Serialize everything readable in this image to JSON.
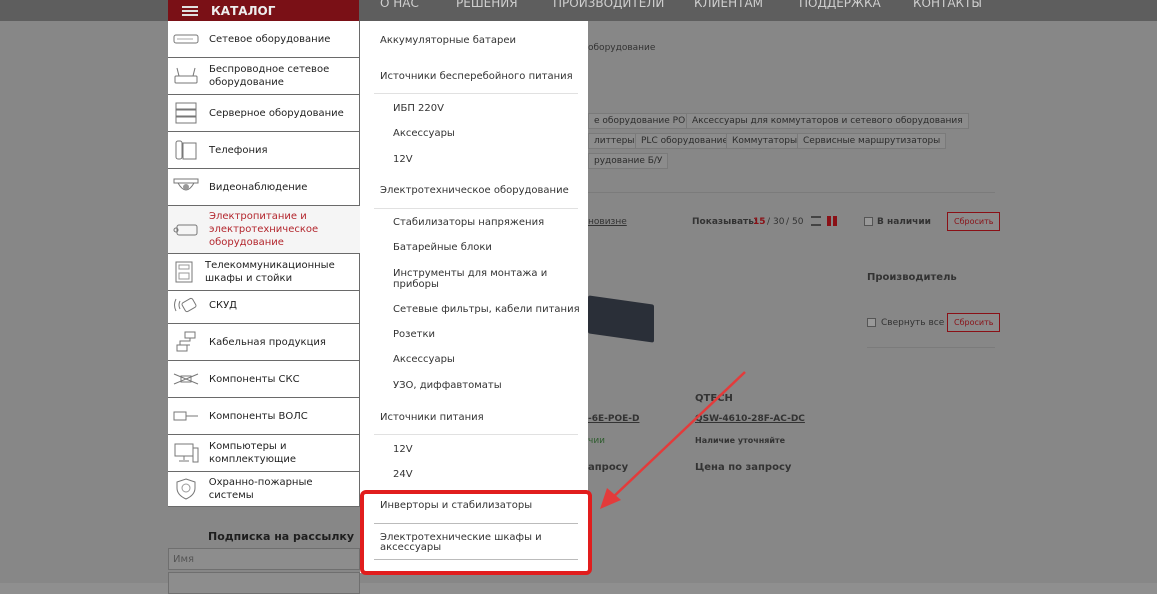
{
  "header": {
    "catalog_label": "КАТАЛОГ",
    "nav": [
      "О НАС",
      "РЕШЕНИЯ",
      "ПРОИЗВОДИТЕЛИ",
      "КЛИЕНТАМ",
      "ПОДДЕРЖКА",
      "КОНТАКТЫ"
    ]
  },
  "left_menu": [
    {
      "label": "Сетевое оборудование",
      "icon": "switch-icon"
    },
    {
      "label": "Беспроводное сетевое оборудование",
      "icon": "wifi-router-icon"
    },
    {
      "label": "Серверное оборудование",
      "icon": "server-icon"
    },
    {
      "label": "Телефония",
      "icon": "phone-icon"
    },
    {
      "label": "Видеонаблюдение",
      "icon": "camera-icon"
    },
    {
      "label": "Электропитание и электротехническое оборудование",
      "icon": "power-icon",
      "active": true
    },
    {
      "label": "Телекоммуникационные шкафы и стойки",
      "icon": "rack-icon"
    },
    {
      "label": "СКУД",
      "icon": "access-control-icon"
    },
    {
      "label": "Кабельная продукция",
      "icon": "cable-icon"
    },
    {
      "label": "Компоненты СКС",
      "icon": "scs-icon"
    },
    {
      "label": "Компоненты ВОЛС",
      "icon": "fiber-icon"
    },
    {
      "label": "Компьютеры и комплектующие",
      "icon": "computer-icon"
    },
    {
      "label": "Охранно-пожарные системы",
      "icon": "shield-icon"
    }
  ],
  "right_menu": {
    "items": [
      {
        "label": "Аккумуляторные батареи",
        "type": "head"
      },
      {
        "label": "Источники бесперебойного питания",
        "type": "head"
      },
      {
        "label": "ИБП 220V",
        "type": "sub"
      },
      {
        "label": "Аксессуары",
        "type": "sub"
      },
      {
        "label": "12V",
        "type": "sub"
      },
      {
        "label": "Электротехническое оборудование",
        "type": "head"
      },
      {
        "label": "Стабилизаторы напряжения",
        "type": "sub"
      },
      {
        "label": "Батарейные блоки",
        "type": "sub"
      },
      {
        "label": "Инструменты для монтажа и приборы",
        "type": "sub"
      },
      {
        "label": "Сетевые фильтры, кабели питания",
        "type": "sub"
      },
      {
        "label": "Розетки",
        "type": "sub"
      },
      {
        "label": "Аксессуары",
        "type": "sub"
      },
      {
        "label": "УЗО, диффавтоматы",
        "type": "sub"
      },
      {
        "label": "Источники питания",
        "type": "head"
      },
      {
        "label": "12V",
        "type": "sub"
      },
      {
        "label": "24V",
        "type": "sub"
      },
      {
        "label": "Инверторы и стабилизаторы",
        "type": "head"
      },
      {
        "label": "Электротехнические шкафы и аксессуары",
        "type": "head"
      }
    ]
  },
  "background": {
    "breadcrumb_tail": "оборудование",
    "chips": [
      "е оборудование PON",
      "Аксессуары для коммутаторов и сетевого оборудования",
      "литтеры",
      "PLC оборудование",
      "Коммутаторы",
      "Сервисные маршрутизаторы",
      "рудование Б/У"
    ],
    "sort_tail": "новизне",
    "show_label": "Показывать:",
    "show_options": [
      "15",
      "30",
      "50"
    ],
    "in_stock_label": "В наличии",
    "reset_label": "Сбросить",
    "manufacturer_label": "Производитель",
    "collapse_all_label": "Свернуть все",
    "product_brand": "QTECH",
    "product_model_1": "-6E-POE-D",
    "product_model_2": "QSW-4610-28F-AC-DC",
    "availability_1": "чии",
    "availability_2": "Наличие уточняйте",
    "price_1": "апросу",
    "price_2": "Цена по запросу",
    "subscribe_title": "Подписка на рассылку",
    "name_placeholder": "Имя"
  },
  "colors": {
    "accent": "#b3262d",
    "highlight": "#e11d1d"
  }
}
